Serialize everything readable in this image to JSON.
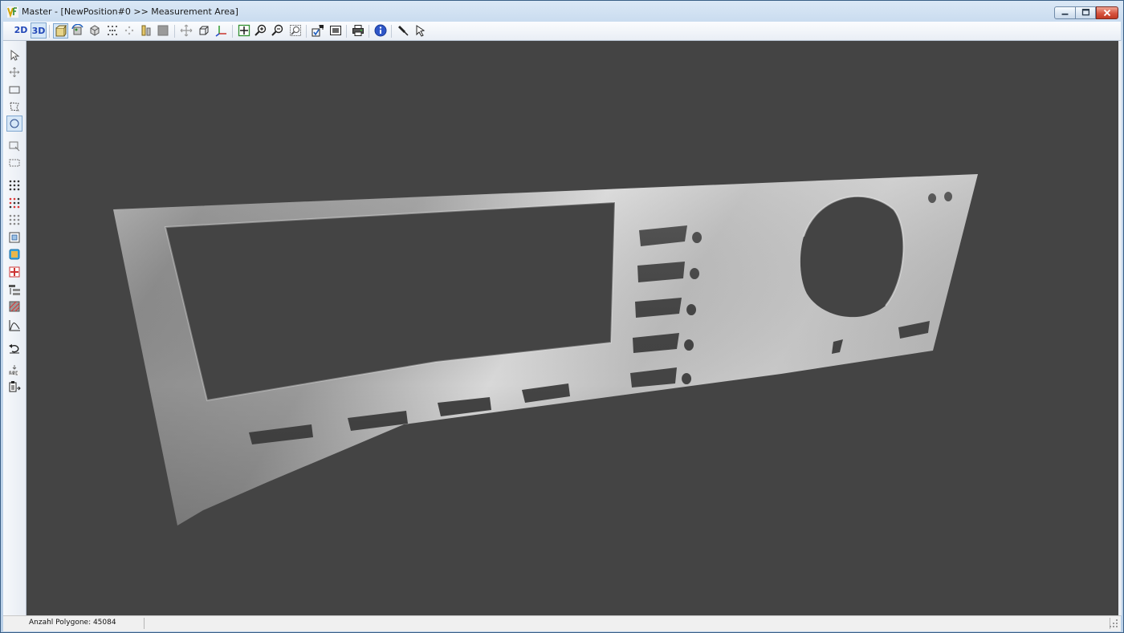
{
  "window": {
    "title": "Master - [NewPosition#0 >> Measurement Area]",
    "controls": [
      "minimize-icon",
      "maximize-icon",
      "close-icon"
    ]
  },
  "toolbar": {
    "view_2d_label": "2D",
    "view_3d_label": "3D",
    "icons": [
      "view-front-icon",
      "view-rotate-icon",
      "cube-icon",
      "point-cloud-icon",
      "move-points-icon",
      "scale-icon",
      "gray-box-icon",
      "pan-icon",
      "box-outline-icon",
      "axis-icon",
      "zoom-fit-icon",
      "zoom-in-icon",
      "zoom-out-icon",
      "zoom-window-icon",
      "edit-check-icon",
      "screenshot-icon",
      "print-icon",
      "info-icon",
      "pin-icon",
      "pointer-tool-icon"
    ]
  },
  "left_toolbar": {
    "icons": [
      "select-arrow-icon",
      "move-icon",
      "rectangle-select-icon",
      "polygon-select-icon",
      "circle-select-icon",
      "rect-deselect-icon",
      "area-select-icon",
      "dot-grid-icon",
      "red-dot-grid-icon",
      "gray-dot-grid-icon",
      "frame-icon",
      "blue-square-icon",
      "red-cross-icon",
      "list-sort-icon",
      "hatch-icon",
      "curve-chart-icon",
      "undo-icon",
      "grc-icon",
      "clipboard-icon"
    ],
    "active": "circle-select-icon"
  },
  "viewport": {
    "background": "#444444",
    "object": "3D scanned perforated metal panel"
  },
  "status": {
    "polygons_text": "Anzahl Polygone: 45084"
  },
  "colors": {
    "accent": "#2348b8",
    "viewport_bg": "#444444",
    "close_red": "#c13a24"
  }
}
